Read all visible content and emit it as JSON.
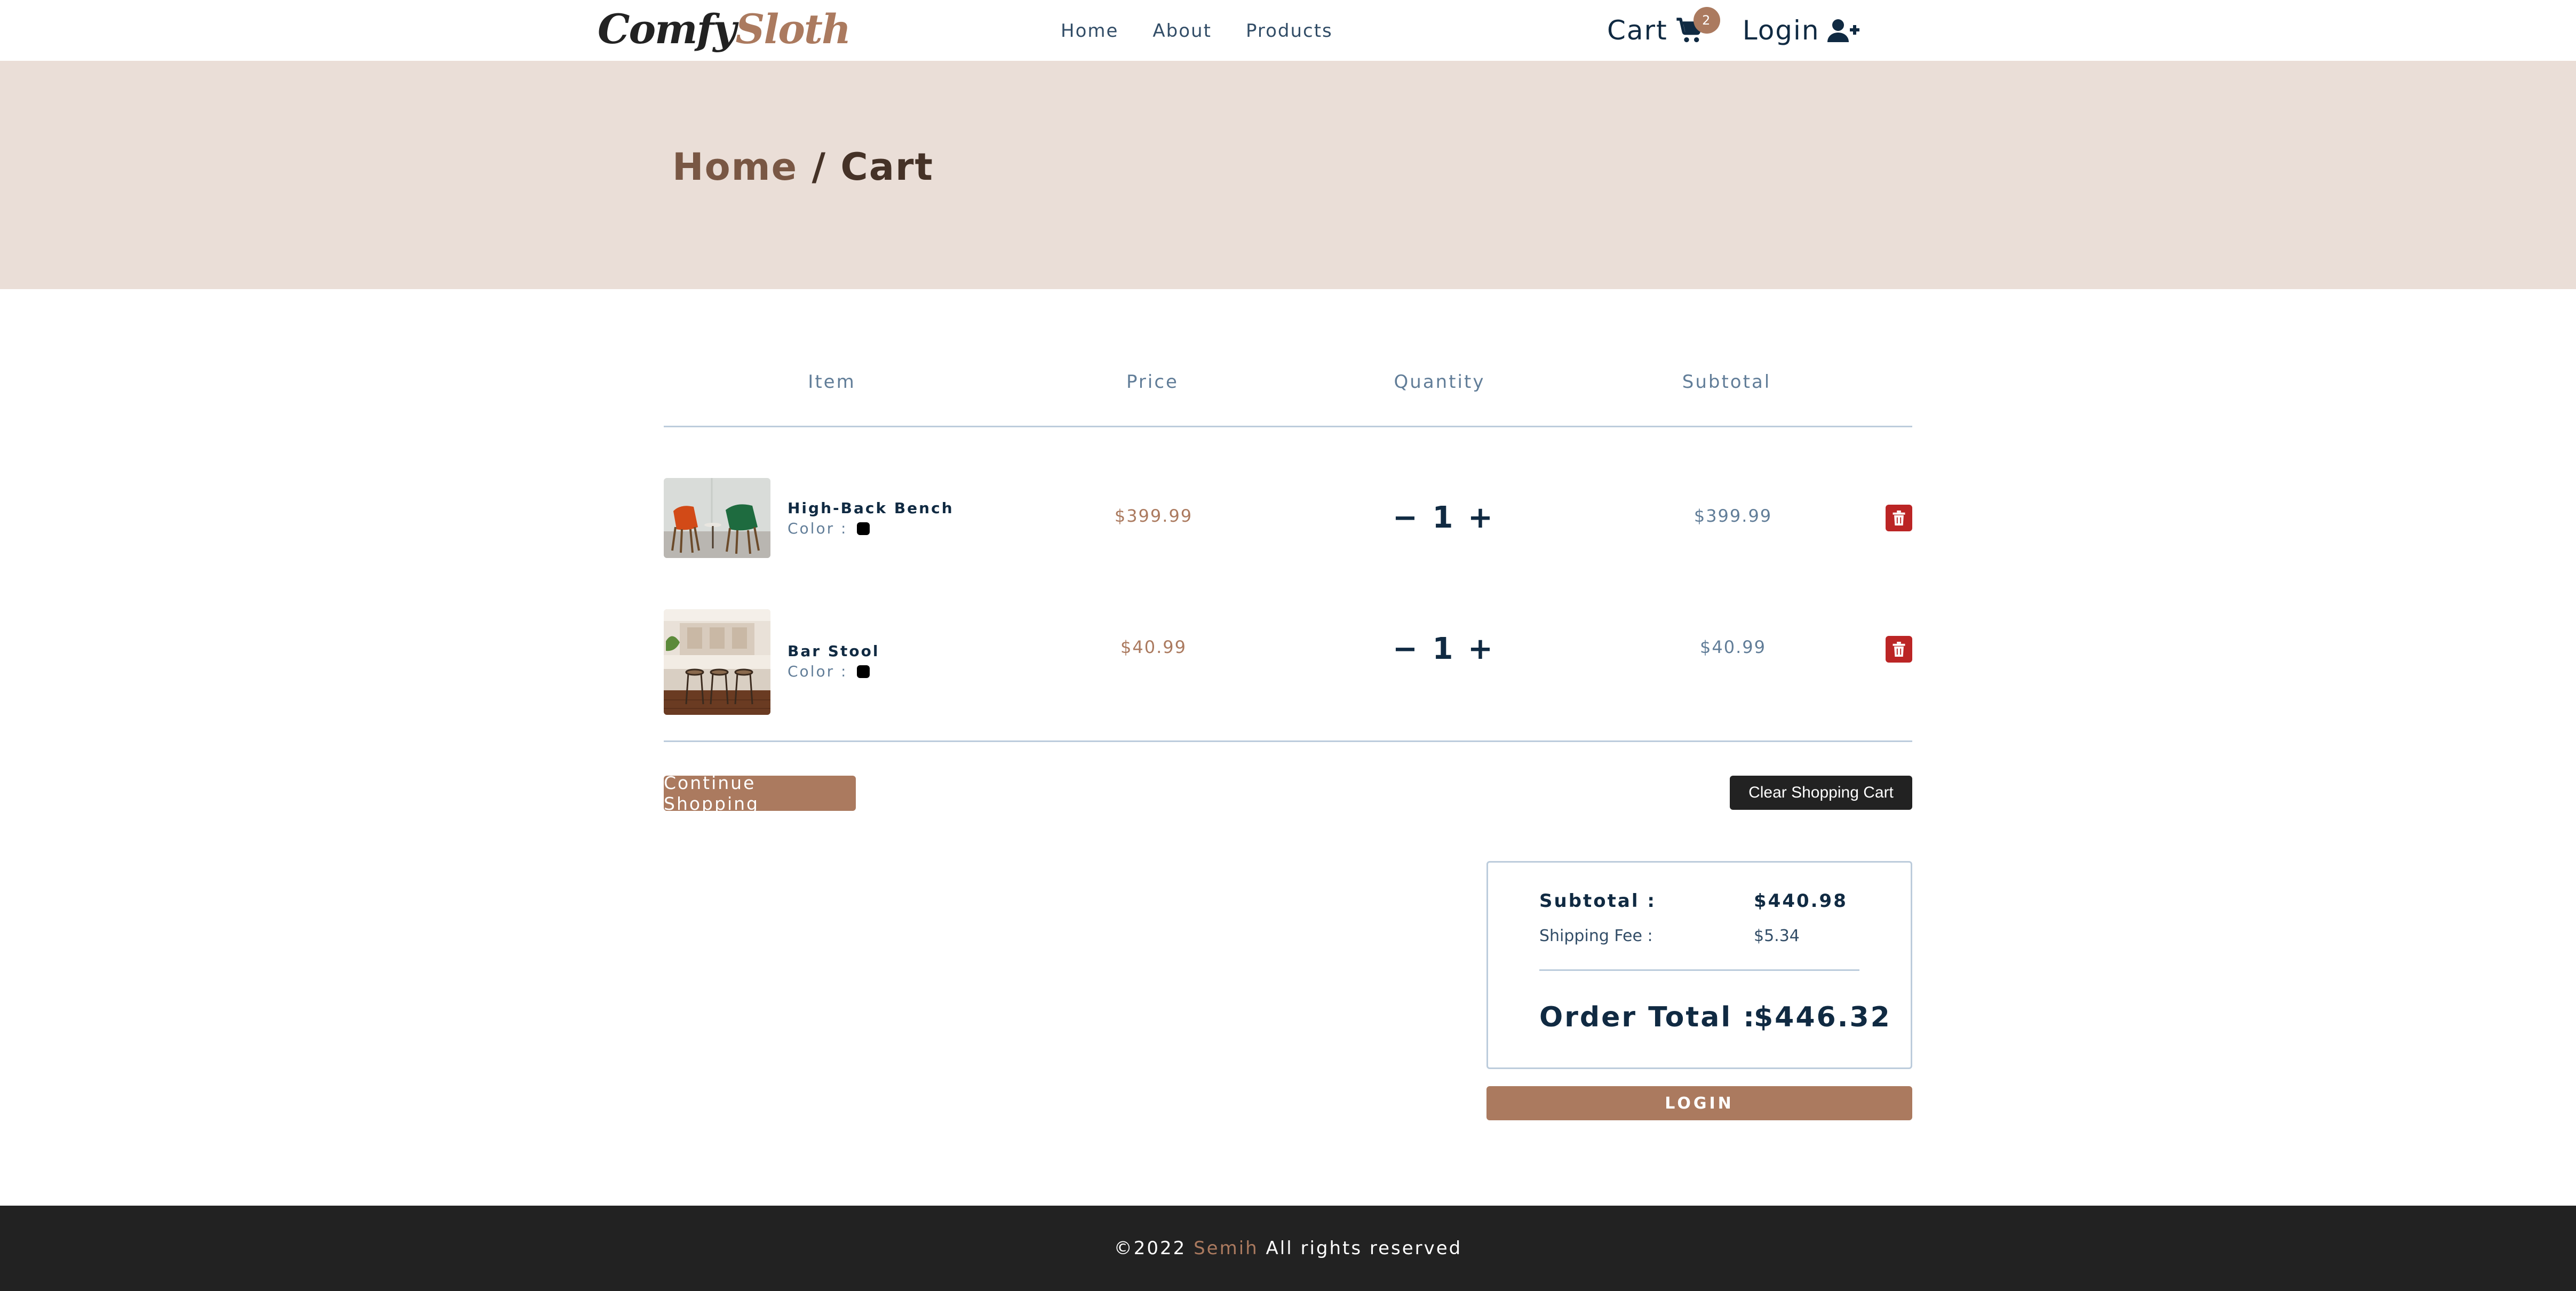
{
  "navbar": {
    "logo_part1": "Comfy",
    "logo_part2": "Sloth",
    "links": [
      {
        "label": "Home"
      },
      {
        "label": "About"
      },
      {
        "label": "Products"
      }
    ],
    "cart_label": "Cart",
    "cart_count": "2",
    "login_label": "Login"
  },
  "hero": {
    "home_link": "Home",
    "separator": " / ",
    "current": "Cart"
  },
  "cart": {
    "headers": {
      "item": "Item",
      "price": "Price",
      "quantity": "Quantity",
      "subtotal": "Subtotal"
    },
    "color_label": "Color :",
    "items": [
      {
        "name": "High-Back Bench",
        "color": "#000000",
        "price": "$399.99",
        "quantity": "1",
        "subtotal": "$399.99",
        "image": "orange-and-green-chairs-photo"
      },
      {
        "name": "Bar Stool",
        "color": "#000000",
        "price": "$40.99",
        "quantity": "1",
        "subtotal": "$40.99",
        "image": "kitchen-bar-stools-photo"
      }
    ],
    "continue_label": "Continue Shopping",
    "clear_label": "Clear Shopping Cart"
  },
  "totals": {
    "subtotal_label": "Subtotal :",
    "subtotal_value": "$440.98",
    "shipping_label": "Shipping Fee :",
    "shipping_value": "$5.34",
    "order_total_label": "Order Total :",
    "order_total_value": "$446.32",
    "login_button": "LOGIN"
  },
  "footer": {
    "copyright": "©2022 ",
    "brand": "Semih",
    "rights": " All rights reserved"
  },
  "colors": {
    "accent": "#ab7a5f",
    "hero_bg": "#eaded7",
    "danger": "#bb2525",
    "dark": "#222222",
    "text": "#102a42",
    "muted": "#617d98"
  }
}
